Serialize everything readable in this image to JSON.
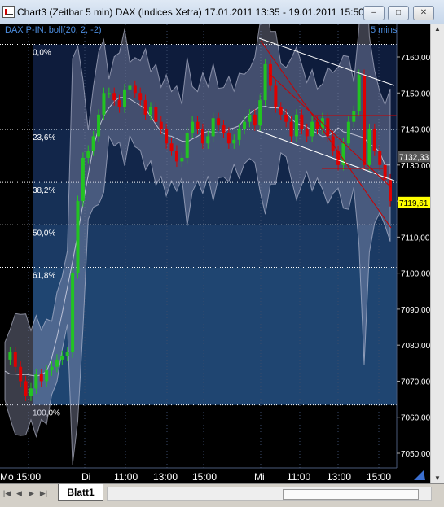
{
  "window": {
    "title": "Chart3 (Zeitbar 5 min)  DAX (Indices Xetra) 17.01.2011 13:35 - 19.01.2011 15:50",
    "minimize": "–",
    "maximize": "□",
    "close": "✕"
  },
  "chart_header": {
    "indicator": "DAX P-IN. boll(20, 2, -2)",
    "interval": "5 mins"
  },
  "chart_data": {
    "type": "line",
    "price_axis": {
      "min": 7050,
      "max": 7160,
      "ticks": [
        "7160,00",
        "7150,00",
        "7140,00",
        "7130,00",
        "7120,00",
        "7110,00",
        "7100,00",
        "7090,00",
        "7080,00",
        "7070,00",
        "7060,00",
        "7050,00"
      ]
    },
    "time_axis": [
      "Mo 15:00",
      "Di",
      "11:00",
      "13:00",
      "15:00",
      "Mi",
      "11:00",
      "13:00",
      "15:00"
    ],
    "fib_levels": [
      {
        "label": "0,0%",
        "price": 7163.5
      },
      {
        "label": "23,6%",
        "price": 7139.9
      },
      {
        "label": "38,2%",
        "price": 7125.2
      },
      {
        "label": "50,0%",
        "price": 7113.4
      },
      {
        "label": "61,8%",
        "price": 7101.6
      },
      {
        "label": "100,0%",
        "price": 7063.4
      }
    ],
    "price_badges": [
      {
        "label": "7132,33",
        "value": 7132.33,
        "color": "#555555"
      },
      {
        "label": "7119,61",
        "value": 7119.61,
        "color": "#ffff00"
      }
    ],
    "close_series": [
      7076,
      7078,
      7074,
      7070,
      7066,
      7068,
      7072,
      7070,
      7073,
      7074,
      7076,
      7077,
      7078,
      7100,
      7120,
      7132,
      7134,
      7138,
      7144,
      7150,
      7150,
      7148,
      7146,
      7151,
      7152,
      7150,
      7148,
      7144,
      7146,
      7142,
      7140,
      7136,
      7134,
      7131,
      7132,
      7139,
      7142,
      7140,
      7136,
      7138,
      7143,
      7141,
      7139,
      7136,
      7137,
      7140,
      7142,
      7144,
      7141,
      7148,
      7158,
      7152,
      7146,
      7144,
      7142,
      7138,
      7144,
      7140,
      7138,
      7142,
      7140,
      7143,
      7138,
      7134,
      7130,
      7136,
      7142,
      7145,
      7155,
      7130,
      7140,
      7134,
      7130,
      7126,
      7120
    ],
    "colors": {
      "up": "#22c322",
      "down": "#e00000",
      "band": "#9aa0c0",
      "fib_line": "#ffffff",
      "channel": "#ffffff",
      "trend": "#cc0000"
    }
  },
  "bottom": {
    "sheet_tab": "Blatt1",
    "nav_first": "|◀",
    "nav_prev": "◀",
    "nav_next": "▶",
    "nav_last": "▶|"
  }
}
